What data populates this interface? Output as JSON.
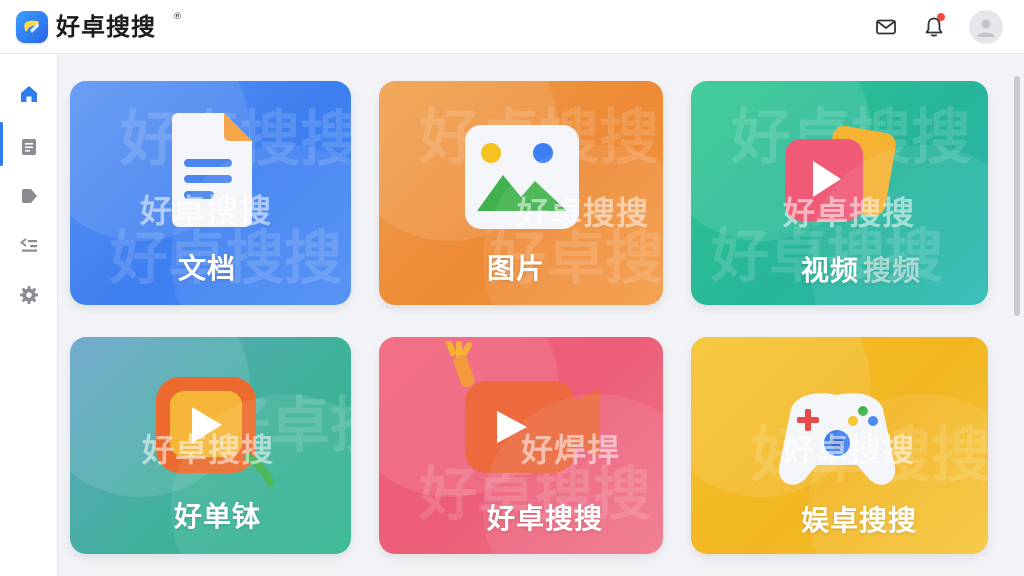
{
  "header": {
    "brand_name": "好卓搜搜",
    "brand_mark": "®",
    "icons": [
      "logo-icon",
      "mail-icon",
      "bell-icon",
      "avatar-icon"
    ],
    "notification_dot": true
  },
  "sidebar": {
    "items": [
      {
        "icon": "home-icon",
        "active": true
      },
      {
        "icon": "document-icon",
        "active": false
      },
      {
        "icon": "tag-icon",
        "active": false
      },
      {
        "icon": "list-icon",
        "active": false
      },
      {
        "icon": "settings-icon",
        "active": false
      }
    ]
  },
  "watermark": "好卓搜搜",
  "cards": [
    {
      "title": "文档",
      "icon": "document-3d-icon",
      "color": "#4b8cf4"
    },
    {
      "title": "图片",
      "icon": "image-3d-icon",
      "color": "#ee8a36"
    },
    {
      "title": "视频",
      "icon": "video-3d-icon",
      "color": "#27b59a",
      "title_suffix": "搜频"
    },
    {
      "title": "好单钵",
      "icon": "play-frame-3d-icon",
      "color": "#40b29b"
    },
    {
      "title": "好卓搜搜",
      "icon": "camera-3d-icon",
      "color": "#ec5d78",
      "overlay_text": "好焊捍"
    },
    {
      "title": "娱卓搜搜",
      "icon": "gamepad-3d-icon",
      "color": "#f2b622",
      "overlay_text": "好卓搜搜"
    }
  ],
  "colors": {
    "accent": "#2f7bf0",
    "notification": "#f24b3c"
  }
}
